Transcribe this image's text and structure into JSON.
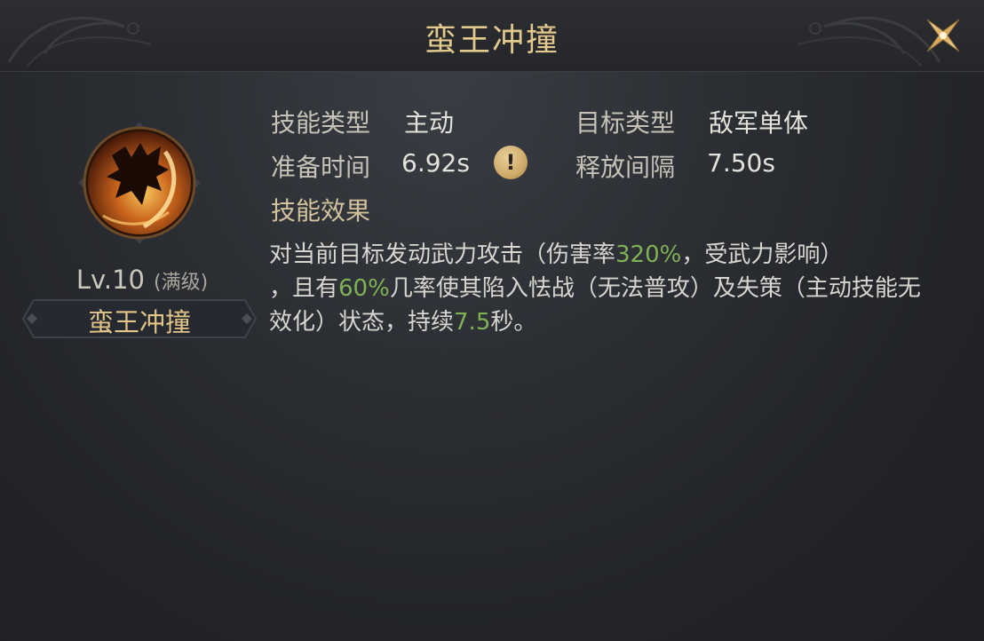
{
  "title": "蛮王冲撞",
  "skill": {
    "level_text": "Lv.10",
    "max_text": "(满级)",
    "name": "蛮王冲撞"
  },
  "info": {
    "skill_type_label": "技能类型",
    "skill_type_value": "主动",
    "target_type_label": "目标类型",
    "target_type_value": "敌军单体",
    "prep_time_label": "准备时间",
    "prep_time_value": "6.92s",
    "interval_label": "释放间隔",
    "interval_value": "7.50s"
  },
  "warn_glyph": "!",
  "effect_label": "技能效果",
  "description": {
    "p1": "对当前目标发动武力攻击（伤害率",
    "damage_rate": "320%",
    "p2": "，受武力影响）",
    "p3": "，且有",
    "chance": "60%",
    "p4": "几率使其陷入怯战（无法普攻）及失策（主动技能无效化）状态，持续",
    "duration": "7.5",
    "p5": "秒。"
  },
  "colors": {
    "gold": "#e3c98e",
    "highlight_green": "#7fb254",
    "text": "#d8d6d0",
    "background": "#2b2e33"
  },
  "icons": {
    "close": "close-x-icon",
    "skill": "dragon-skill-icon",
    "warning": "exclamation-icon"
  }
}
